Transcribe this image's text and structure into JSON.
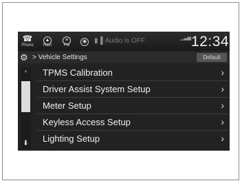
{
  "statusbar": {
    "phone_label": "Phone",
    "navi_label": "Navi",
    "fm_label": "FM",
    "audio_status": "Audio is OFF",
    "clock": "12:34"
  },
  "titlebar": {
    "breadcrumb": "Vehicle Settings",
    "default_label": "Default"
  },
  "menu": {
    "items": [
      {
        "label": "TPMS Calibration"
      },
      {
        "label": "Driver Assist System Setup"
      },
      {
        "label": "Meter Setup"
      },
      {
        "label": "Keyless Access Setup"
      },
      {
        "label": "Lighting Setup"
      }
    ]
  },
  "icons": {
    "phone": "phone-icon",
    "navi": "navi-icon",
    "fm": "fm-icon",
    "media": "media-icon",
    "speaker": "speaker-icon",
    "gear": "gear-icon",
    "chevron": "chevron-right-icon"
  }
}
